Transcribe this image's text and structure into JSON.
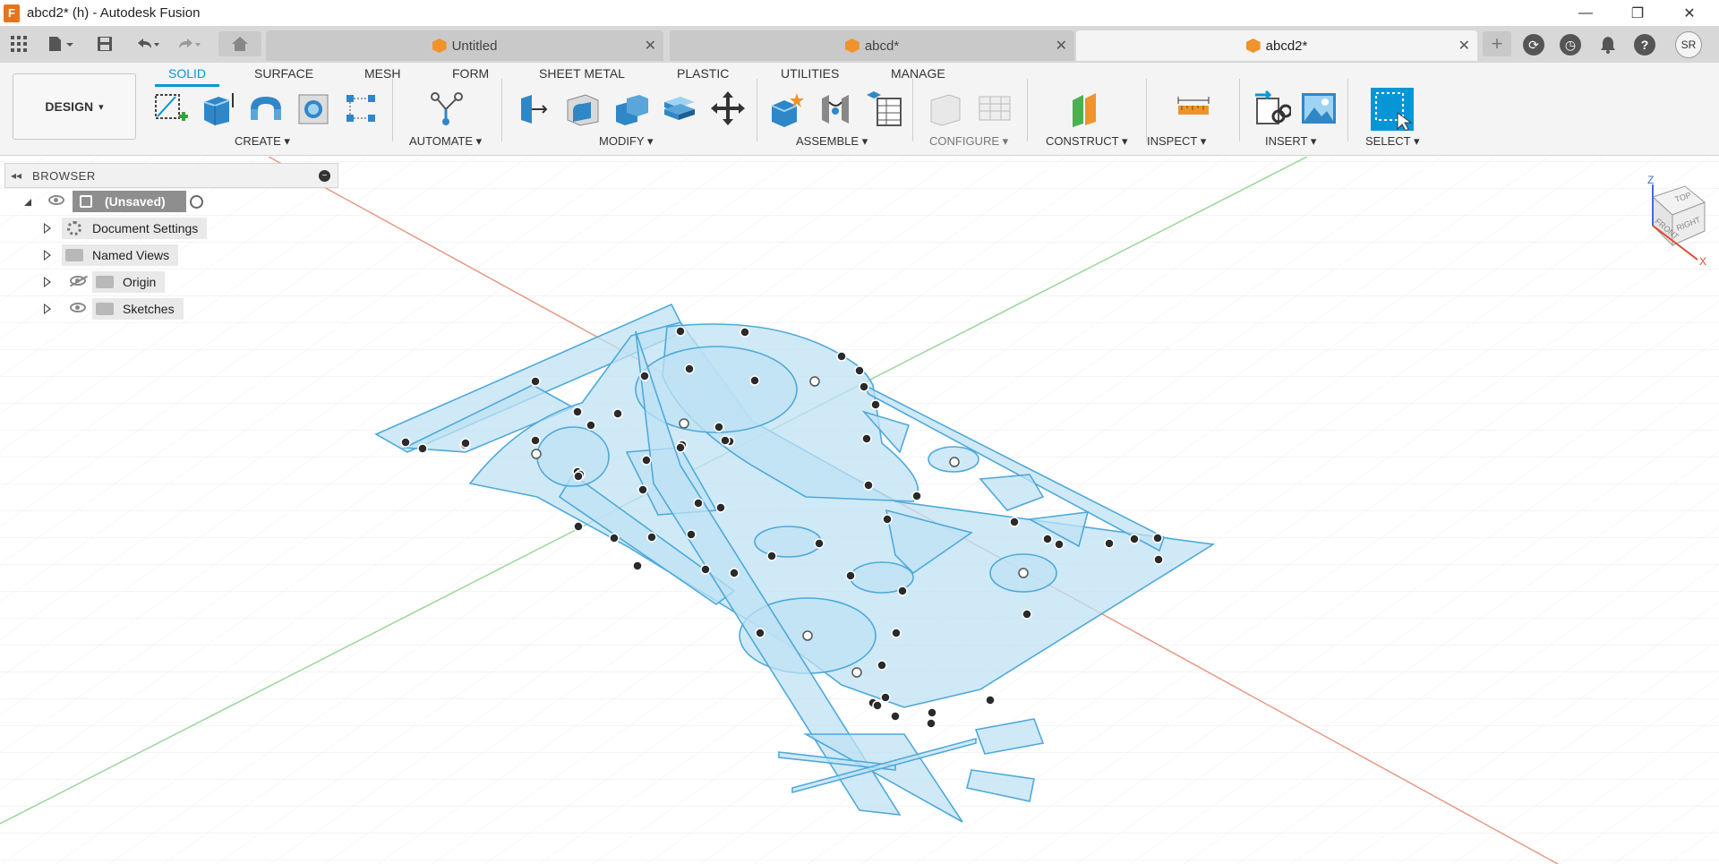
{
  "window": {
    "title": "abcd2* (h) - Autodesk Fusion",
    "app_icon_letter": "F",
    "controls": {
      "minimize": "—",
      "maximize": "❐",
      "close": "✕"
    }
  },
  "tabs": {
    "documents": [
      {
        "label": "Untitled",
        "active": false
      },
      {
        "label": "abcd*",
        "active": false
      },
      {
        "label": "abcd2*",
        "active": true
      }
    ],
    "close_glyph": "✕",
    "user_initials": "SR"
  },
  "ribbon": {
    "workspace": "DESIGN",
    "tabs": [
      "SOLID",
      "SURFACE",
      "MESH",
      "FORM",
      "SHEET METAL",
      "PLASTIC",
      "UTILITIES",
      "MANAGE"
    ],
    "active_tab": "SOLID",
    "groups": {
      "create": "CREATE",
      "automate": "AUTOMATE",
      "modify": "MODIFY",
      "assemble": "ASSEMBLE",
      "configure": "CONFIGURE",
      "construct": "CONSTRUCT",
      "inspect": "INSPECT",
      "insert": "INSERT",
      "select": "SELECT"
    },
    "dropdown_glyph": "▾",
    "accent_color": "#0696d7"
  },
  "browser": {
    "title": "BROWSER",
    "collapse_glyph": "◂◂",
    "minimize_glyph": "−",
    "root": "(Unsaved)",
    "items": [
      {
        "label": "Document Settings",
        "icon": "gear-icon"
      },
      {
        "label": "Named Views",
        "icon": "folder-icon"
      },
      {
        "label": "Origin",
        "icon": "folder-icon",
        "visibility": "hidden"
      },
      {
        "label": "Sketches",
        "icon": "folder-icon",
        "visibility": "visible"
      }
    ]
  },
  "viewcube": {
    "top": "TOP",
    "front": "FRONT",
    "right": "RIGHT",
    "z_axis": "Z",
    "x_axis": "X"
  },
  "colors": {
    "sketch_fill": "#bfe1f4",
    "sketch_stroke": "#4fa9d9",
    "x_axis": "#e07a5f",
    "y_axis": "#7cc77c",
    "grid": "#e3e3e3"
  }
}
